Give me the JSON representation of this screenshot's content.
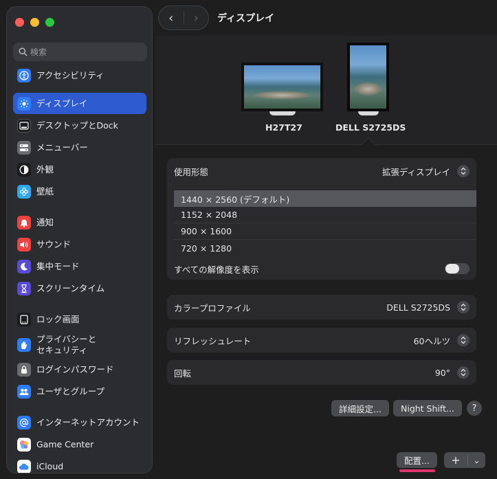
{
  "window": {
    "title": "ディスプレイ"
  },
  "search": {
    "placeholder": "検索"
  },
  "sidebar": {
    "items": [
      {
        "label": "アクセシビリティ",
        "icon": "accessibility-icon",
        "color": "#2f7cf6"
      },
      {
        "label": "ディスプレイ",
        "icon": "display-brightness-icon",
        "color": "#2f7cf6",
        "active": true
      },
      {
        "label": "デスクトップとDock",
        "icon": "dock-icon",
        "color": "#1c1c1e"
      },
      {
        "label": "メニューバー",
        "icon": "menubar-icon",
        "color": "#6b6b6f"
      },
      {
        "label": "外観",
        "icon": "appearance-icon",
        "color": "#1c1c1e"
      },
      {
        "label": "壁紙",
        "icon": "wallpaper-icon",
        "color": "#2fa8f0"
      },
      {
        "label": "通知",
        "icon": "bell-icon",
        "color": "#ef4140"
      },
      {
        "label": "サウンド",
        "icon": "speaker-icon",
        "color": "#ef4140"
      },
      {
        "label": "集中モード",
        "icon": "moon-icon",
        "color": "#5a4bd6"
      },
      {
        "label": "スクリーンタイム",
        "icon": "hourglass-icon",
        "color": "#5a4bd6"
      },
      {
        "label": "ロック画面",
        "icon": "lock-screen-icon",
        "color": "#1c1c1e"
      },
      {
        "label": "プライバシーと\nセキュリティ",
        "icon": "hand-icon",
        "color": "#2f7cf6"
      },
      {
        "label": "ログインパスワード",
        "icon": "lock-icon",
        "color": "#6b6b6f"
      },
      {
        "label": "ユーザとグループ",
        "icon": "users-icon",
        "color": "#2f7cf6"
      },
      {
        "label": "インターネットアカウント",
        "icon": "at-icon",
        "color": "#2f7cf6"
      },
      {
        "label": "Game Center",
        "icon": "game-center-icon",
        "color": "#ffffff"
      },
      {
        "label": "iCloud",
        "icon": "cloud-icon",
        "color": "#ffffff"
      }
    ]
  },
  "monitors": [
    {
      "name": "H27T27"
    },
    {
      "name": "DELL S2725DS"
    }
  ],
  "usage": {
    "label": "使用形態",
    "value": "拡張ディスプレイ"
  },
  "resolutions": [
    {
      "label": "1440 × 2560 (デフォルト)",
      "selected": true
    },
    {
      "label": "1152 × 2048"
    },
    {
      "label": "900 × 1600"
    },
    {
      "label": "720 × 1280"
    }
  ],
  "show_all_resolutions": {
    "label": "すべての解像度を表示",
    "on": false
  },
  "color_profile": {
    "label": "カラープロファイル",
    "value": "DELL S2725DS"
  },
  "refresh_rate": {
    "label": "リフレッシュレート",
    "value": "60ヘルツ"
  },
  "rotation": {
    "label": "回転",
    "value": "90°"
  },
  "buttons": {
    "advanced": "詳細設定...",
    "night_shift": "Night Shift...",
    "help": "?",
    "arrange": "配置...",
    "add": "+",
    "add_menu": "⌄"
  },
  "colors": {
    "accent": "#2f5bd1",
    "highlight_underline": "#e0336c"
  }
}
